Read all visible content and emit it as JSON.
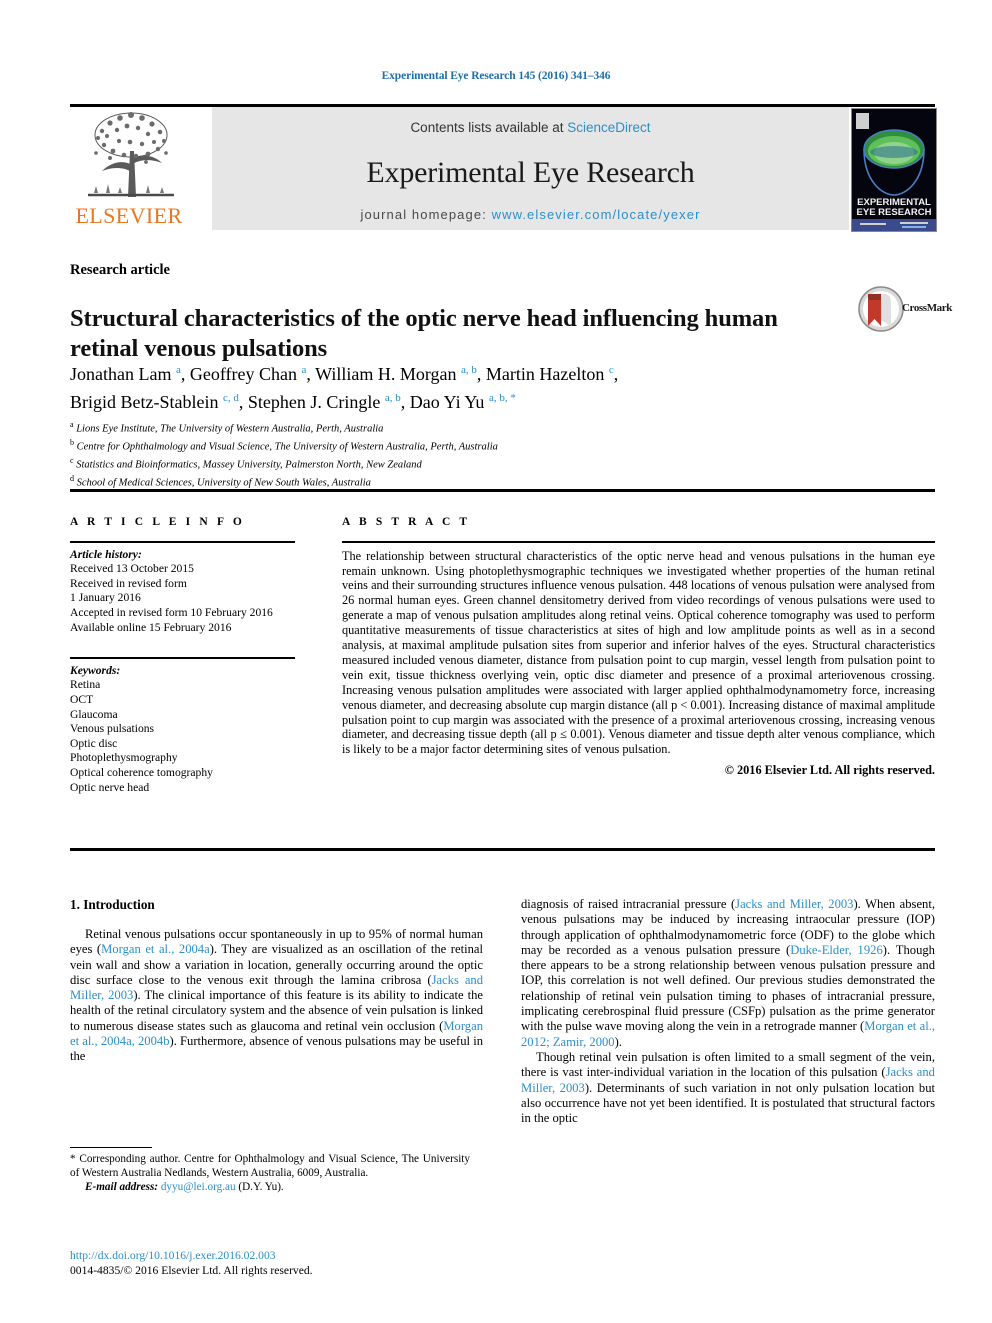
{
  "header": {
    "running_head": "Experimental Eye Research 145 (2016) 341–346"
  },
  "masthead": {
    "contents_text": "Contents lists available at ",
    "sciencedirect": "ScienceDirect",
    "journal_title": "Experimental Eye Research",
    "homepage_label": "journal homepage: ",
    "homepage_url": "www.elsevier.com/locate/yexer",
    "publisher_name": "ELSEVIER",
    "cover_title_line1": "EXPERIMENTAL",
    "cover_title_line2": "EYE RESEARCH"
  },
  "article": {
    "type": "Research article",
    "title": "Structural characteristics of the optic nerve head influencing human retinal venous pulsations",
    "crossmark_label": "CrossMark",
    "authors_line1": "Jonathan Lam <sup>a</sup>, Geoffrey Chan <sup>a</sup>, William H. Morgan <sup>a, b</sup>, Martin Hazelton <sup>c</sup>,",
    "authors_line2": "Brigid Betz-Stablein <sup>c, d</sup>, Stephen J. Cringle <sup>a, b</sup>, Dao Yi Yu <sup>a, b, *</sup>",
    "affiliations": [
      {
        "marker": "a",
        "text": "Lions Eye Institute, The University of Western Australia, Perth, Australia"
      },
      {
        "marker": "b",
        "text": "Centre for Ophthalmology and Visual Science, The University of Western Australia, Perth, Australia"
      },
      {
        "marker": "c",
        "text": "Statistics and Bioinformatics, Massey University, Palmerston North, New Zealand"
      },
      {
        "marker": "d",
        "text": "School of Medical Sciences, University of New South Wales, Australia"
      }
    ]
  },
  "article_info": {
    "heading": "A R T I C L E   I N F O",
    "history_label": "Article history:",
    "history_lines": [
      "Received 13 October 2015",
      "Received in revised form",
      "1 January 2016",
      "Accepted in revised form 10 February 2016",
      "Available online 15 February 2016"
    ],
    "keywords_label": "Keywords:",
    "keywords": [
      "Retina",
      "OCT",
      "Glaucoma",
      "Venous pulsations",
      "Optic disc",
      "Photoplethysmography",
      "Optical coherence tomography",
      "Optic nerve head"
    ]
  },
  "abstract": {
    "heading": "A B S T R A C T",
    "text": "The relationship between structural characteristics of the optic nerve head and venous pulsations in the human eye remain unknown. Using photoplethysmographic techniques we investigated whether properties of the human retinal veins and their surrounding structures influence venous pulsation. 448 locations of venous pulsation were analysed from 26 normal human eyes. Green channel densitometry derived from video recordings of venous pulsations were used to generate a map of venous pulsation amplitudes along retinal veins. Optical coherence tomography was used to perform quantitative measurements of tissue characteristics at sites of high and low amplitude points as well as in a second analysis, at maximal amplitude pulsation sites from superior and inferior halves of the eyes. Structural characteristics measured included venous diameter, distance from pulsation point to cup margin, vessel length from pulsation point to vein exit, tissue thickness overlying vein, optic disc diameter and presence of a proximal arteriovenous crossing. Increasing venous pulsation amplitudes were associated with larger applied ophthalmodynamometry force, increasing venous diameter, and decreasing absolute cup margin distance (all p < 0.001). Increasing distance of maximal amplitude pulsation point to cup margin was associated with the presence of a proximal arteriovenous crossing, increasing venous diameter, and decreasing tissue depth (all p ≤ 0.001). Venous diameter and tissue depth alter venous compliance, which is likely to be a major factor determining sites of venous pulsation.",
    "copyright": "© 2016 Elsevier Ltd. All rights reserved."
  },
  "introduction": {
    "heading": "1. Introduction",
    "left_paragraph": "Retinal venous pulsations occur spontaneously in up to 95% of normal human eyes (Morgan et al., 2004a). They are visualized as an oscillation of the retinal vein wall and show a variation in location, generally occurring around the optic disc surface close to the venous exit through the lamina cribrosa (Jacks and Miller, 2003). The clinical importance of this feature is its ability to indicate the health of the retinal circulatory system and the absence of vein pulsation is linked to numerous disease states such as glaucoma and retinal vein occlusion (Morgan et al., 2004a, 2004b). Furthermore, absence of venous pulsations may be useful in the",
    "right_paragraph_1": "diagnosis of raised intracranial pressure (Jacks and Miller, 2003). When absent, venous pulsations may be induced by increasing intraocular pressure (IOP) through application of ophthalmodynamometric force (ODF) to the globe which may be recorded as a venous pulsation pressure (Duke-Elder, 1926). Though there appears to be a strong relationship between venous pulsation pressure and IOP, this correlation is not well defined. Our previous studies demonstrated the relationship of retinal vein pulsation timing to phases of intracranial pressure, implicating cerebrospinal fluid pressure (CSFp) pulsation as the prime generator with the pulse wave moving along the vein in a retrograde manner (Morgan et al., 2012; Zamir, 2000).",
    "right_paragraph_2": "Though retinal vein pulsation is often limited to a small segment of the vein, there is vast inter-individual variation in the location of this pulsation (Jacks and Miller, 2003). Determinants of such variation in not only pulsation location but also occurrence have not yet been identified. It is postulated that structural factors in the optic"
  },
  "footer": {
    "corresponding_marker": "*",
    "corresponding_text": "Corresponding author. Centre for Ophthalmology and Visual Science, The University of Western Australia Nedlands, Western Australia, 6009, Australia.",
    "email_label": "E-mail address:",
    "email": "dyyu@lei.org.au",
    "email_owner": "(D.Y. Yu).",
    "doi": "http://dx.doi.org/10.1016/j.exer.2016.02.003",
    "issn_copyright": "0014-4835/© 2016 Elsevier Ltd. All rights reserved."
  },
  "colors": {
    "link": "#2b8fc9",
    "elsevier_orange": "#E87722",
    "band_gray": "#e6e6e6"
  }
}
